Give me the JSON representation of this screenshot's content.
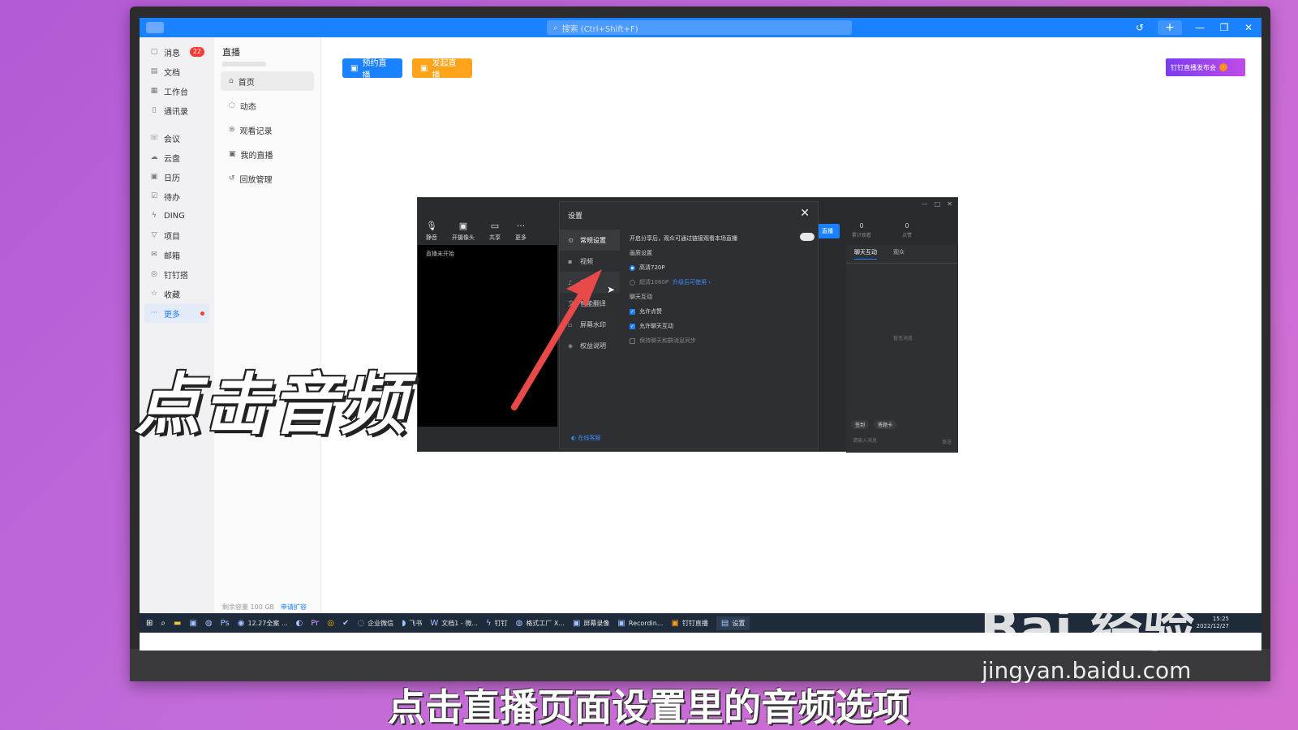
{
  "titlebar": {
    "search_placeholder": "搜索 (Ctrl+Shift+F)"
  },
  "leftnav": {
    "items": [
      {
        "label": "消息",
        "badge": "22"
      },
      {
        "label": "文档"
      },
      {
        "label": "工作台"
      },
      {
        "label": "通讯录"
      },
      {
        "label": "会议"
      },
      {
        "label": "云盘"
      },
      {
        "label": "日历"
      },
      {
        "label": "待办"
      },
      {
        "label": "DING"
      },
      {
        "label": "项目"
      },
      {
        "label": "邮箱"
      },
      {
        "label": "钉钉搭"
      },
      {
        "label": "收藏"
      },
      {
        "label": "更多"
      }
    ]
  },
  "subnav": {
    "title": "直播",
    "items": [
      "首页",
      "动态",
      "观看记录",
      "我的直播",
      "回放管理"
    ],
    "storage_text": "剩余容量 100 GB",
    "storage_link": "申请扩容"
  },
  "main": {
    "btn_schedule": "预约直播",
    "btn_start": "发起直播",
    "promo": "钉钉直播发布会"
  },
  "live": {
    "toolbar": [
      "静音",
      "开摄像头",
      "共享",
      "更多"
    ],
    "status": "直播未开始",
    "start_btn": "直播",
    "stats": [
      {
        "value": "0",
        "label": "累计观看"
      },
      {
        "value": "0",
        "label": "点赞"
      }
    ],
    "chat_tabs": [
      "聊天互动",
      "观众"
    ],
    "chat_empty": "暂无消息",
    "chat_tags": [
      "签到",
      "答题卡"
    ],
    "chat_input": "请输入消息",
    "chat_send": "发送"
  },
  "settings": {
    "title": "设置",
    "menu": [
      "常规设置",
      "视频",
      "音频",
      "智能翻译",
      "屏幕水印",
      "权益说明"
    ],
    "help": "在线客服",
    "share_text": "开启分享后，观众可通过链接观看本场直播",
    "quality_head": "画质设置",
    "quality_720": "高清720P",
    "quality_1080": "超清1080P",
    "quality_1080_link": "升级后可使用 ›",
    "chat_head": "聊天互动",
    "allow_like": "允许点赞",
    "allow_chat": "允许聊天互动",
    "sync_chat": "保持聊天和群消息同步"
  },
  "taskbar": {
    "items": [
      "12.27全案 ...",
      "企业微信",
      "飞书",
      "文档1 - 微...",
      "钉钉",
      "格式工厂 X...",
      "屏幕录像",
      "Recordin...",
      "钉钉直播",
      "设置"
    ],
    "clock_time": "15:25",
    "clock_date": "2022/12/27"
  },
  "overlay": {
    "caption": "点击音频",
    "subtitle": "点击直播页面设置里的音频选项",
    "watermark": "Bai 经验",
    "watermark_url": "jingyan.baidu.com"
  },
  "colors": {
    "accent": "#1a82ff",
    "orange": "#ffa31a",
    "arrow": "#e84a4a"
  }
}
